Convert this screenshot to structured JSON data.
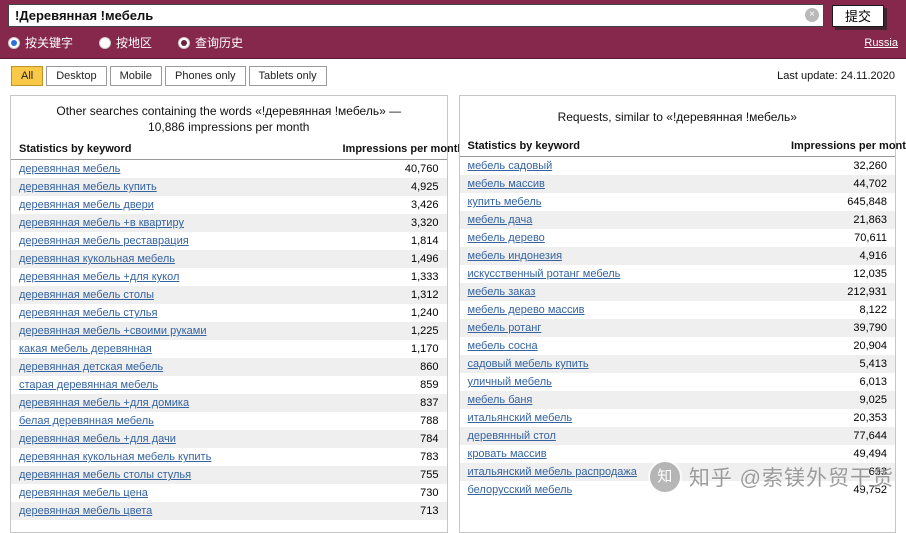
{
  "colors": {
    "topbar_bg": "#85284C",
    "tab_active_bg": "#F8C846",
    "link_blue": "#3563A0",
    "row_stripe": "#EFEFEF",
    "radio_selected": "#2F6FD9"
  },
  "topbar": {
    "search_value": "!Деревянная !мебель",
    "clear_icon": "×",
    "submit_label": "提交",
    "radios": [
      {
        "label": "按关键字",
        "selected": true
      },
      {
        "label": "按地区",
        "selected": false
      },
      {
        "label": "查询历史",
        "selected": false
      }
    ],
    "region_label": "Russia"
  },
  "tabs": {
    "items": [
      {
        "label": "All",
        "active": true
      },
      {
        "label": "Desktop",
        "active": false
      },
      {
        "label": "Mobile",
        "active": false
      },
      {
        "label": "Phones only",
        "active": false
      },
      {
        "label": "Tablets only",
        "active": false
      }
    ],
    "last_update": "Last update: 24.11.2020"
  },
  "left_panel": {
    "title": "Other searches containing the words «!деревянная !мебель» — 10,886 impressions per month",
    "col_keyword": "Statistics by keyword",
    "col_impressions": "Impressions per month",
    "help_icon": "?",
    "rows": [
      {
        "keyword": "деревянная мебель",
        "impressions": "40,760"
      },
      {
        "keyword": "деревянная мебель купить",
        "impressions": "4,925"
      },
      {
        "keyword": "деревянная мебель двери",
        "impressions": "3,426"
      },
      {
        "keyword": "деревянная мебель +в квартиру",
        "impressions": "3,320"
      },
      {
        "keyword": "деревянная мебель реставрация",
        "impressions": "1,814"
      },
      {
        "keyword": "деревянная кукольная мебель",
        "impressions": "1,496"
      },
      {
        "keyword": "деревянная мебель +для кукол",
        "impressions": "1,333"
      },
      {
        "keyword": "деревянная мебель столы",
        "impressions": "1,312"
      },
      {
        "keyword": "деревянная мебель стулья",
        "impressions": "1,240"
      },
      {
        "keyword": "деревянная мебель +своими руками",
        "impressions": "1,225"
      },
      {
        "keyword": "какая мебель деревянная",
        "impressions": "1,170"
      },
      {
        "keyword": "деревянная детская мебель",
        "impressions": "860"
      },
      {
        "keyword": "старая деревянная мебель",
        "impressions": "859"
      },
      {
        "keyword": "деревянная мебель +для домика",
        "impressions": "837"
      },
      {
        "keyword": "белая деревянная мебель",
        "impressions": "788"
      },
      {
        "keyword": "деревянная мебель +для дачи",
        "impressions": "784"
      },
      {
        "keyword": "деревянная кукольная мебель купить",
        "impressions": "783"
      },
      {
        "keyword": "деревянная мебель столы стулья",
        "impressions": "755"
      },
      {
        "keyword": "деревянная мебель цена",
        "impressions": "730"
      },
      {
        "keyword": "деревянная мебель цвета",
        "impressions": "713"
      }
    ]
  },
  "right_panel": {
    "title": "Requests, similar to «!деревянная !мебель»",
    "col_keyword": "Statistics by keyword",
    "col_impressions": "Impressions per month",
    "help_icon": "?",
    "rows": [
      {
        "keyword": "мебель садовый",
        "impressions": "32,260"
      },
      {
        "keyword": "мебель массив",
        "impressions": "44,702"
      },
      {
        "keyword": "купить мебель",
        "impressions": "645,848"
      },
      {
        "keyword": "мебель дача",
        "impressions": "21,863"
      },
      {
        "keyword": "мебель дерево",
        "impressions": "70,611"
      },
      {
        "keyword": "мебель индонезия",
        "impressions": "4,916"
      },
      {
        "keyword": "искусственный ротанг мебель",
        "impressions": "12,035"
      },
      {
        "keyword": "мебель заказ",
        "impressions": "212,931"
      },
      {
        "keyword": "мебель дерево массив",
        "impressions": "8,122"
      },
      {
        "keyword": "мебель ротанг",
        "impressions": "39,790"
      },
      {
        "keyword": "мебель сосна",
        "impressions": "20,904"
      },
      {
        "keyword": "садовый мебель купить",
        "impressions": "5,413"
      },
      {
        "keyword": "уличный мебель",
        "impressions": "6,013"
      },
      {
        "keyword": "мебель баня",
        "impressions": "9,025"
      },
      {
        "keyword": "итальянский мебель",
        "impressions": "20,353"
      },
      {
        "keyword": "деревянный стол",
        "impressions": "77,644"
      },
      {
        "keyword": "кровать массив",
        "impressions": "49,494"
      },
      {
        "keyword": "итальянский мебель распродажа",
        "impressions": "633"
      },
      {
        "keyword": "белорусский мебель",
        "impressions": "49,752"
      }
    ]
  },
  "watermark": {
    "logo_glyph": "知",
    "text": "知乎 @索镁外贸干货"
  }
}
